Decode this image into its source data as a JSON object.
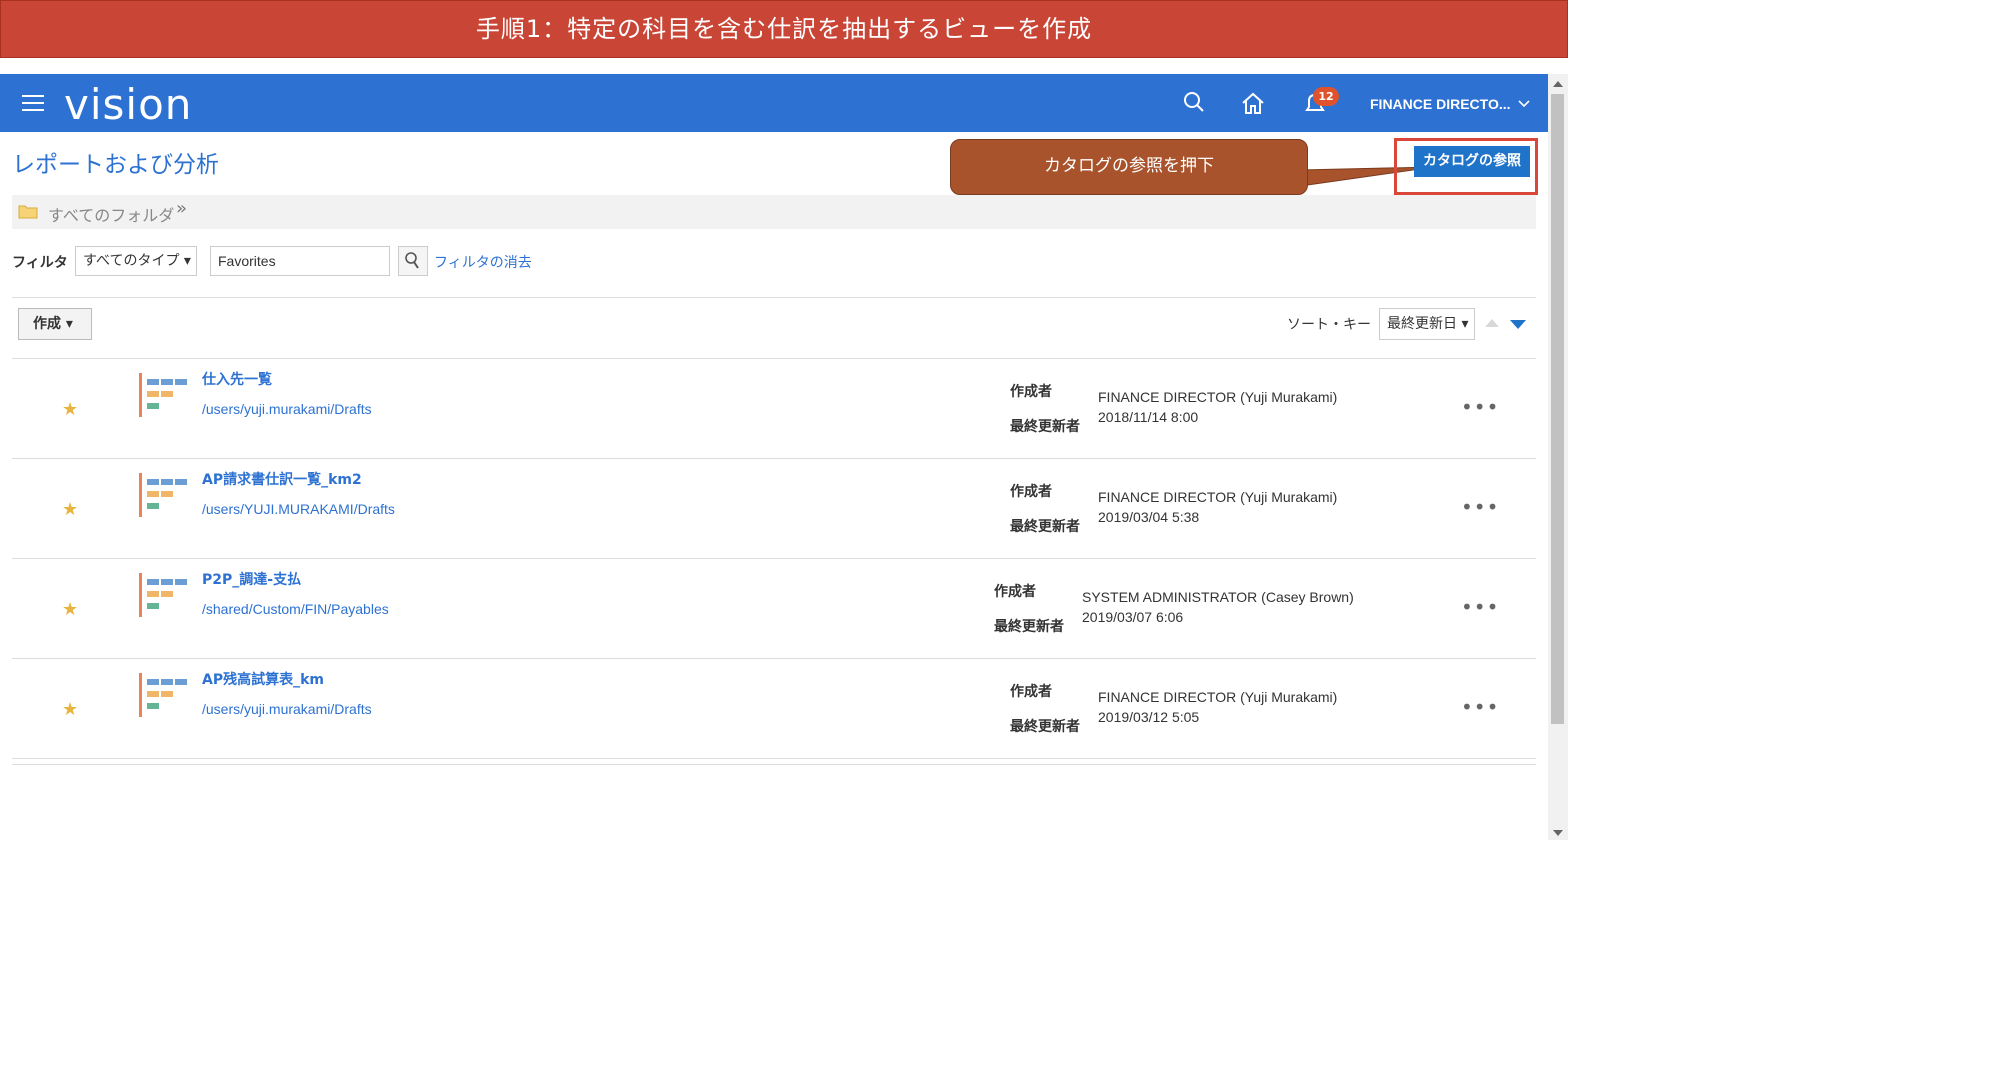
{
  "banner": {
    "text": "手順1：特定の科目を含む仕訳を抽出するビューを作成"
  },
  "header": {
    "logo": "vision",
    "notification_count": "12",
    "user": "FINANCE DIRECTO...",
    "icons": [
      "menu-icon",
      "search-icon",
      "home-icon",
      "notification-icon",
      "chevron-down-icon"
    ],
    "color": "#2d72d2"
  },
  "page": {
    "title": "レポートおよび分析",
    "catalog_button": "カタログの参照",
    "callout": "カタログの参照を押下",
    "breadcrumb": {
      "label": "すべてのフォルダ",
      "arrow": "»"
    }
  },
  "filter": {
    "label": "フィルタ",
    "type_value": "すべてのタイプ ▾",
    "search_value": "Favorites",
    "clear_label": "フィルタの消去"
  },
  "toolbar": {
    "create_label": "作成 ▾",
    "sort_label": "ソート・キー",
    "sort_value": "最終更新日 ▾"
  },
  "labels": {
    "created_by": "作成者",
    "modified_by": "最終更新者"
  },
  "items": [
    {
      "name": "仕入先一覧",
      "path": "/users/yuji.murakami/Drafts",
      "owner": "FINANCE DIRECTOR (Yuji Murakami)",
      "date": "2018/11/14 8:00"
    },
    {
      "name": "AP請求書仕訳一覧_km2",
      "path": "/users/YUJI.MURAKAMI/Drafts",
      "owner": "FINANCE DIRECTOR (Yuji Murakami)",
      "date": "2019/03/04 5:38"
    },
    {
      "name": "P2P_調達-支払",
      "path": "/shared/Custom/FIN/Payables",
      "owner": "SYSTEM ADMINISTRATOR (Casey Brown)",
      "date": "2019/03/07 6:06"
    },
    {
      "name": "AP残高試算表_km",
      "path": "/users/yuji.murakami/Drafts",
      "owner": "FINANCE DIRECTOR (Yuji Murakami)",
      "date": "2019/03/12 5:05"
    }
  ],
  "more_glyph": "•••"
}
